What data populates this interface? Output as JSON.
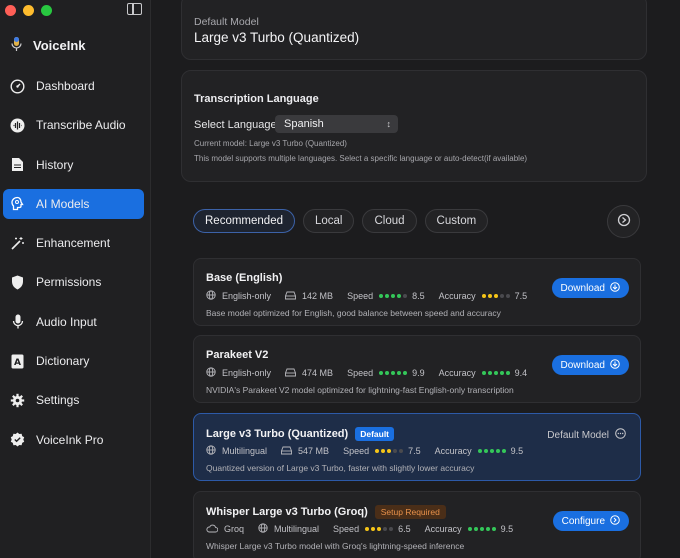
{
  "sidebar": {
    "brand": "VoiceInk",
    "items": [
      {
        "label": "Dashboard",
        "icon": "dashboard-icon",
        "active": false
      },
      {
        "label": "Transcribe Audio",
        "icon": "waveform-icon",
        "active": false
      },
      {
        "label": "History",
        "icon": "document-icon",
        "active": false
      },
      {
        "label": "AI Models",
        "icon": "brain-icon",
        "active": true
      },
      {
        "label": "Enhancement",
        "icon": "magic-wand-icon",
        "active": false
      },
      {
        "label": "Permissions",
        "icon": "shield-icon",
        "active": false
      },
      {
        "label": "Audio Input",
        "icon": "microphone-icon",
        "active": false
      },
      {
        "label": "Dictionary",
        "icon": "dictionary-icon",
        "active": false
      },
      {
        "label": "Settings",
        "icon": "gear-icon",
        "active": false
      },
      {
        "label": "VoiceInk Pro",
        "icon": "verified-badge-icon",
        "active": false
      }
    ]
  },
  "default_model": {
    "label": "Default Model",
    "value": "Large v3 Turbo (Quantized)"
  },
  "transcription_language": {
    "title": "Transcription Language",
    "select_label": "Select Language",
    "selected": "Spanish",
    "current_model": "Current model: Large v3 Turbo (Quantized)",
    "note": "This model supports multiple languages. Select a specific language or auto-detect(if available)"
  },
  "tabs": [
    {
      "label": "Recommended",
      "active": true
    },
    {
      "label": "Local",
      "active": false
    },
    {
      "label": "Cloud",
      "active": false
    },
    {
      "label": "Custom",
      "active": false
    }
  ],
  "models": [
    {
      "name": "Base (English)",
      "language": "English-only",
      "size": "142 MB",
      "speed_label": "Speed",
      "speed": "8.5",
      "speed_dots": 4,
      "accuracy_label": "Accuracy",
      "accuracy": "7.5",
      "accuracy_dots": 3,
      "description": "Base model optimized for English, good balance between speed and accuracy",
      "action": "Download"
    },
    {
      "name": "Parakeet V2",
      "language": "English-only",
      "size": "474 MB",
      "speed_label": "Speed",
      "speed": "9.9",
      "speed_dots": 5,
      "accuracy_label": "Accuracy",
      "accuracy": "9.4",
      "accuracy_dots": 5,
      "description": "NVIDIA's Parakeet V2 model optimized for lightning-fast English-only transcription",
      "action": "Download"
    },
    {
      "name": "Large v3 Turbo (Quantized)",
      "badge": "Default",
      "language": "Multilingual",
      "size": "547 MB",
      "speed_label": "Speed",
      "speed": "7.5",
      "speed_dots": 3,
      "accuracy_label": "Accuracy",
      "accuracy": "9.5",
      "accuracy_dots": 5,
      "description": "Quantized version of Large v3 Turbo, faster with slightly lower accuracy",
      "status": "Default Model"
    },
    {
      "name": "Whisper Large v3 Turbo (Groq)",
      "badge": "Setup Required",
      "provider": "Groq",
      "language": "Multilingual",
      "speed_label": "Speed",
      "speed": "6.5",
      "speed_dots": 3,
      "accuracy_label": "Accuracy",
      "accuracy": "9.5",
      "accuracy_dots": 5,
      "description": "Whisper Large v3 Turbo model with Groq's lightning-speed inference",
      "action": "Configure"
    }
  ],
  "colors": {
    "accent": "#1a6fe0",
    "dot_green": "#34c759",
    "dot_yellow": "#f5c518",
    "dot_off": "#4a4a4e",
    "traffic_red": "#ff5f57",
    "traffic_yellow": "#febc2e",
    "traffic_green": "#28c840"
  }
}
